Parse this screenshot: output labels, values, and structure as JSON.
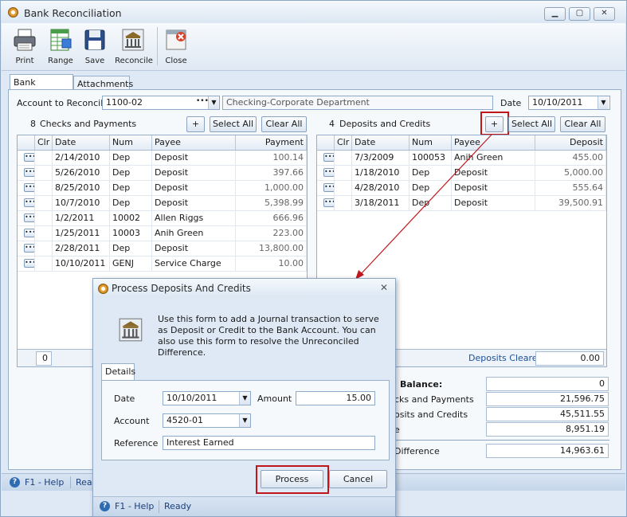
{
  "window": {
    "title": "Bank Reconciliation"
  },
  "toolbar": {
    "buttons": [
      {
        "label": "Print",
        "icon": "printer-icon"
      },
      {
        "label": "Range",
        "icon": "range-icon"
      },
      {
        "label": "Save",
        "icon": "save-icon"
      },
      {
        "label": "Reconcile",
        "icon": "bank-icon"
      },
      {
        "label": "Close",
        "icon": "close-icon"
      }
    ]
  },
  "tabs": [
    "Bank Accounts",
    "Attachments"
  ],
  "account": {
    "label": "Account to Reconcile",
    "value": "1100-02",
    "description": "Checking-Corporate Department"
  },
  "date": {
    "label": "Date",
    "value": "10/10/2011"
  },
  "checks": {
    "count": "8",
    "title": "Checks and Payments",
    "add_label": "+",
    "select_all": "Select All",
    "clear_all": "Clear All",
    "columns": [
      "Clr",
      "Date",
      "Num",
      "Payee",
      "Payment"
    ],
    "rows": [
      {
        "date": "2/14/2010",
        "num": "Dep",
        "payee": "Deposit",
        "amount": "100.14"
      },
      {
        "date": "5/26/2010",
        "num": "Dep",
        "payee": "Deposit",
        "amount": "397.66"
      },
      {
        "date": "8/25/2010",
        "num": "Dep",
        "payee": "Deposit",
        "amount": "1,000.00"
      },
      {
        "date": "10/7/2010",
        "num": "Dep",
        "payee": "Deposit",
        "amount": "5,398.99"
      },
      {
        "date": "1/2/2011",
        "num": "10002",
        "payee": "Allen Riggs",
        "amount": "666.96"
      },
      {
        "date": "1/25/2011",
        "num": "10003",
        "payee": "Anih Green",
        "amount": "223.00"
      },
      {
        "date": "2/28/2011",
        "num": "Dep",
        "payee": "Deposit",
        "amount": "13,800.00"
      },
      {
        "date": "10/10/2011",
        "num": "GENJ",
        "payee": "Service Charge",
        "amount": "10.00"
      }
    ],
    "footer_count": "0"
  },
  "deposits": {
    "count": "4",
    "title": "Deposits and Credits",
    "add_label": "+",
    "select_all": "Select All",
    "clear_all": "Clear All",
    "columns": [
      "Clr",
      "Date",
      "Num",
      "Payee",
      "Deposit"
    ],
    "rows": [
      {
        "date": "7/3/2009",
        "num": "100053",
        "payee": "Anih Green",
        "amount": "455.00"
      },
      {
        "date": "1/18/2010",
        "num": "Dep",
        "payee": "Deposit",
        "amount": "5,000.00"
      },
      {
        "date": "4/28/2010",
        "num": "Dep",
        "payee": "Deposit",
        "amount": "555.64"
      },
      {
        "date": "3/18/2011",
        "num": "Dep",
        "payee": "Deposit",
        "amount": "39,500.91"
      }
    ],
    "footer_label": "Deposits Cleared",
    "footer_value": "0.00"
  },
  "summary": [
    {
      "label": "Balance:",
      "value": "0"
    },
    {
      "label": "cks and Payments",
      "value": "21,596.75"
    },
    {
      "label": "osits and Credits",
      "value": "45,511.55"
    },
    {
      "label": "e",
      "value": "8,951.19"
    },
    {
      "label": "Difference",
      "value": "14,963.61"
    }
  ],
  "status": {
    "help": "F1 - Help",
    "text": "Rea"
  },
  "dialog": {
    "title": "Process Deposits And Credits",
    "description": "Use this form to add a Journal transaction to serve as Deposit or Credit to the Bank Account. You can also use this form to resolve the Unreconciled Difference.",
    "tab": "Details",
    "date_label": "Date",
    "date_value": "10/10/2011",
    "amount_label": "Amount",
    "amount_value": "15.00",
    "account_label": "Account",
    "account_value": "4520-01",
    "reference_label": "Reference",
    "reference_value": "Interest Earned",
    "process_label": "Process",
    "cancel_label": "Cancel",
    "status_help": "F1 - Help",
    "status_text": "Ready"
  },
  "colors": {
    "highlight": "#c0171c",
    "accent": "#1a4f9c"
  }
}
